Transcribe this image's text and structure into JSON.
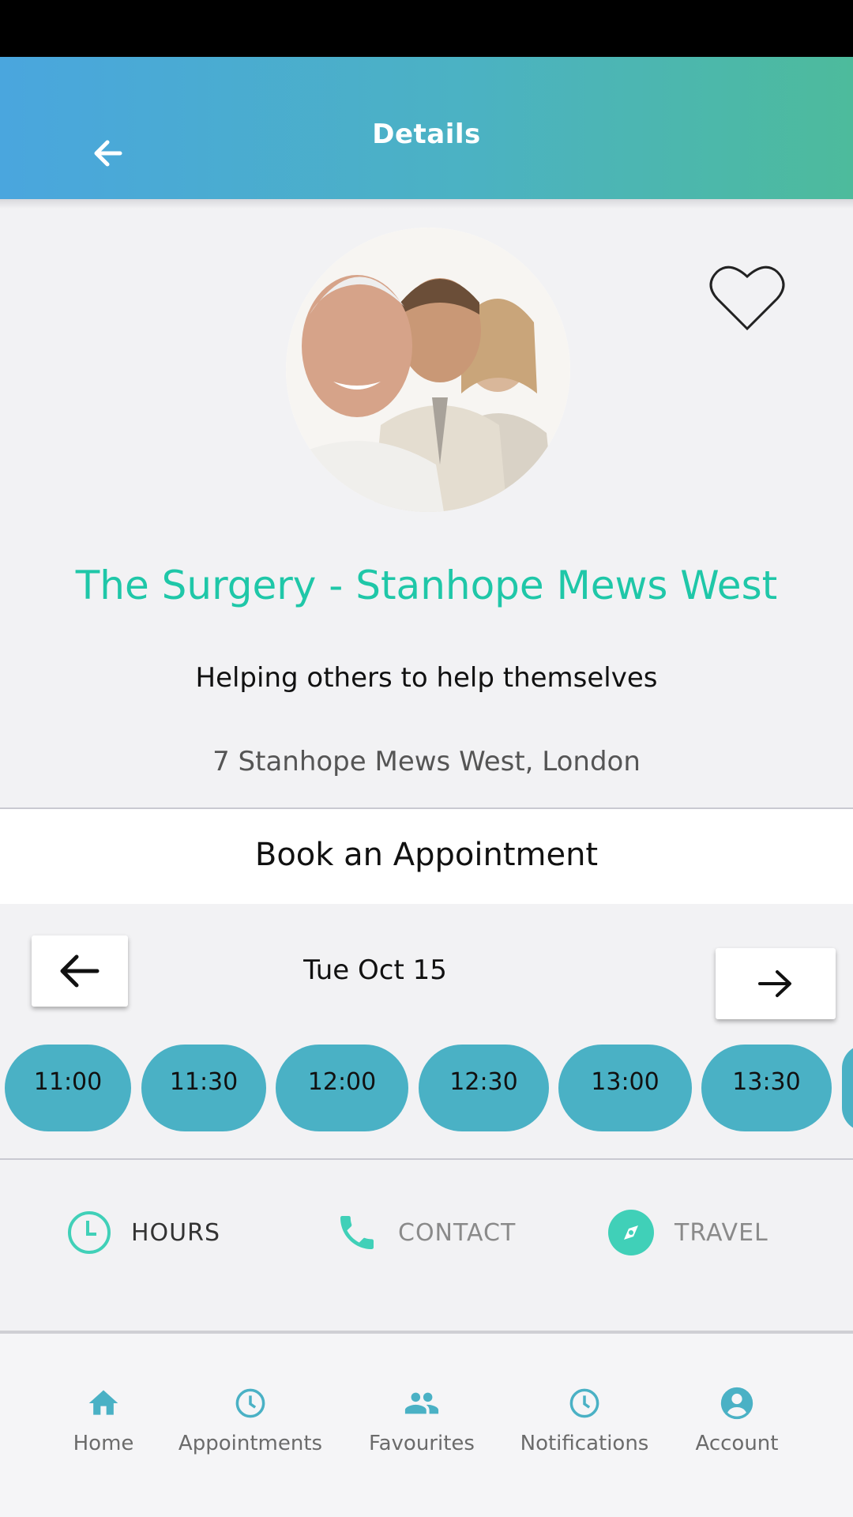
{
  "header": {
    "title": "Details"
  },
  "practice": {
    "name": "The Surgery - Stanhope Mews West",
    "tagline": "Helping others to help themselves",
    "address": "7 Stanhope Mews West, London"
  },
  "booking": {
    "title": "Book an Appointment",
    "date": "Tue Oct 15",
    "slots": [
      "11:00",
      "11:30",
      "12:00",
      "12:30",
      "13:00",
      "13:30"
    ]
  },
  "info_tabs": {
    "hours": "HOURS",
    "contact": "CONTACT",
    "travel": "TRAVEL"
  },
  "bottom_nav": {
    "home": "Home",
    "appointments": "Appointments",
    "favourites": "Favourites",
    "notifications": "Notifications",
    "account": "Account"
  },
  "colors": {
    "accent": "#1fc7a8",
    "slot": "#4ab1c5",
    "header_start": "#4aa6de",
    "header_end": "#4dbb9c",
    "nav_icon": "#4ab1c5"
  }
}
